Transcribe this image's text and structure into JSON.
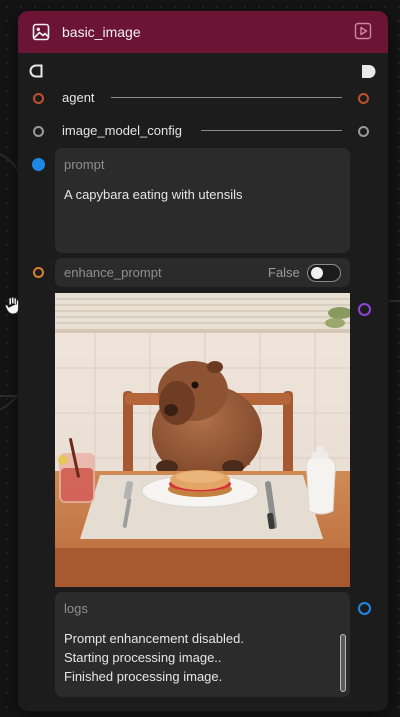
{
  "node": {
    "title": "basic_image",
    "header_color": "#6b1434",
    "icons": {
      "node": "image-icon",
      "run": "play-square-icon"
    }
  },
  "inputs": [
    {
      "label": "agent",
      "port_color": "#c0502a"
    },
    {
      "label": "image_model_config",
      "port_color": "#9a9a9a"
    }
  ],
  "prompt": {
    "label": "prompt",
    "value": "A capybara eating with utensils",
    "port_color": "#1e88e5"
  },
  "enhance_prompt": {
    "label": "enhance_prompt",
    "value_label": "False",
    "checked": false,
    "port_color": "#d9822b"
  },
  "output_image": {
    "port_color": "#8e44d8",
    "description_icon": "capybara-image"
  },
  "logs": {
    "label": "logs",
    "lines": [
      "Prompt enhancement disabled.",
      "Starting processing image..",
      "Finished processing image."
    ],
    "port_color": "#1e88e5"
  }
}
